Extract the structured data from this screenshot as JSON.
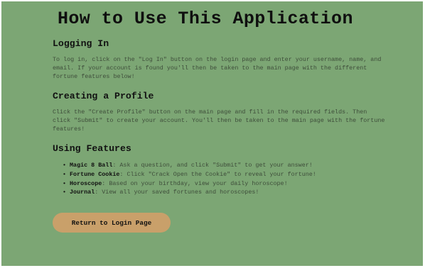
{
  "page": {
    "title": "How to Use This Application"
  },
  "sections": [
    {
      "heading": "Logging In",
      "text": "To log in, click on the \"Log In\" button on the login page and enter your username, name, and email. If your account is found you'll then be taken to the main page with the different fortune features below!"
    },
    {
      "heading": "Creating a Profile",
      "text": "Click the \"Create Profile\" button on the main page and fill in the required fields. Then click \"Submit\" to create your account. You'll then be taken to the main page with the fortune features!"
    },
    {
      "heading": "Using Features",
      "features": [
        {
          "name": "Magic 8 Ball",
          "desc": ": Ask a question, and click \"Submit\" to get your answer!"
        },
        {
          "name": "Fortune Cookie",
          "desc": ": Click \"Crack Open the Cookie\" to reveal your fortune!"
        },
        {
          "name": "Horoscope",
          "desc": ": Based on your birthday, view your daily horoscope!"
        },
        {
          "name": "Journal",
          "desc": ": View all your saved fortunes and horoscopes!"
        }
      ]
    }
  ],
  "button": {
    "label": "Return to Login Page"
  },
  "colors": {
    "background": "#7ca674",
    "button": "#c9a06a"
  }
}
